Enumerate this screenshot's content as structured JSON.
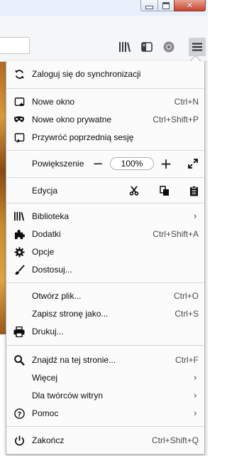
{
  "window": {
    "close_glyph": "✕"
  },
  "menu": {
    "sync": {
      "label": "Zaloguj się do synchronizacji",
      "icon": "sync-icon"
    },
    "new_window": {
      "label": "Nowe okno",
      "shortcut": "Ctrl+N",
      "icon": "new-window-icon"
    },
    "private_window": {
      "label": "Nowe okno prywatne",
      "shortcut": "Ctrl+Shift+P",
      "icon": "private-mask-icon"
    },
    "restore_session": {
      "label": "Przywróć poprzednią sesję",
      "icon": "restore-session-icon"
    },
    "zoom": {
      "label": "Powiększenie",
      "minus": "−",
      "value": "100%",
      "plus": "+"
    },
    "edit": {
      "label": "Edycja"
    },
    "library": {
      "label": "Biblioteka",
      "chevron": "›",
      "icon": "library-icon"
    },
    "addons": {
      "label": "Dodatki",
      "shortcut": "Ctrl+Shift+A",
      "icon": "puzzle-icon"
    },
    "options": {
      "label": "Opcje",
      "icon": "gear-icon"
    },
    "customize": {
      "label": "Dostosuj...",
      "icon": "paintbrush-icon"
    },
    "open_file": {
      "label": "Otwórz plik...",
      "shortcut": "Ctrl+O"
    },
    "save_page": {
      "label": "Zapisz stronę jako...",
      "shortcut": "Ctrl+S"
    },
    "print": {
      "label": "Drukuj...",
      "icon": "printer-icon"
    },
    "find": {
      "label": "Znajdź na tej stronie...",
      "shortcut": "Ctrl+F",
      "icon": "search-icon"
    },
    "more": {
      "label": "Więcej",
      "chevron": "›"
    },
    "web_dev": {
      "label": "Dla twórców witryn",
      "chevron": "›"
    },
    "help": {
      "label": "Pomoc",
      "chevron": "›",
      "icon": "help-icon"
    },
    "quit": {
      "label": "Zakończ",
      "shortcut": "Ctrl+Shift+Q",
      "icon": "power-icon"
    }
  },
  "colors": {
    "menu_bg": "#fbfbfb",
    "separator": "#d7d7db",
    "toolbar_bg": "#f5f6f7",
    "close_red": "#c7432e"
  }
}
